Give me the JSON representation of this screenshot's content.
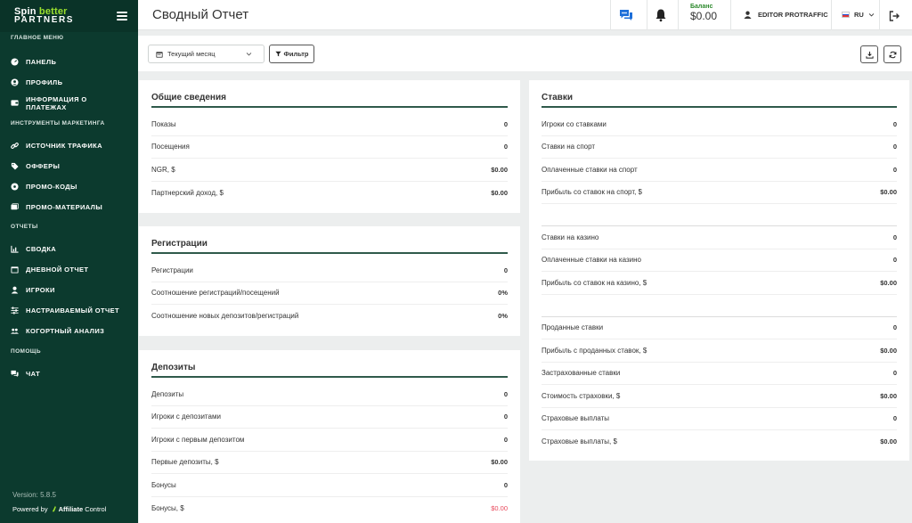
{
  "app": {
    "logo_line1_a": "Spin",
    "logo_line1_b": "better",
    "logo_line2": "PARTNERS",
    "version": "Version: 5.8.5",
    "powered_by": "Powered by",
    "powered_brand_a": "Affiliate",
    "powered_brand_b": "Control"
  },
  "sidebar": {
    "sections": [
      {
        "title": "ГЛАВНОЕ МЕНЮ",
        "items": [
          {
            "label": "ПАНЕЛЬ",
            "icon": "dashboard-icon"
          },
          {
            "label": "ПРОФИЛЬ",
            "icon": "user-icon"
          },
          {
            "label": "ИНФОРМАЦИЯ О ПЛАТЕЖАХ",
            "icon": "wallet-icon"
          }
        ]
      },
      {
        "title": "ИНСТРУМЕНТЫ МАРКЕТИНГА",
        "items": [
          {
            "label": "ИСТОЧНИК ТРАФИКА",
            "icon": "link-icon"
          },
          {
            "label": "ОФФЕРЫ",
            "icon": "tag-icon"
          },
          {
            "label": "ПРОМО-КОДЫ",
            "icon": "promo-icon"
          },
          {
            "label": "ПРОМО-МАТЕРИАЛЫ",
            "icon": "images-icon"
          }
        ]
      },
      {
        "title": "ОТЧЕТЫ",
        "items": [
          {
            "label": "СВОДКА",
            "icon": "chart-icon"
          },
          {
            "label": "ДНЕВНОЙ ОТЧЕТ",
            "icon": "calendar-icon"
          },
          {
            "label": "ИГРОКИ",
            "icon": "user-icon"
          },
          {
            "label": "НАСТРАИВАЕМЫЙ ОТЧЕТ",
            "icon": "sliders-icon"
          },
          {
            "label": "КОГОРТНЫЙ АНАЛИЗ",
            "icon": "users-icon"
          }
        ]
      },
      {
        "title": "ПОМОЩЬ",
        "items": [
          {
            "label": "ЧАТ",
            "icon": "chat-icon"
          }
        ]
      }
    ]
  },
  "header": {
    "title": "Сводный Отчет",
    "balance_label": "Баланс",
    "balance_value": "$0.00",
    "user_name": "EDITOR PROTRAFFIC",
    "language": "RU"
  },
  "toolbar": {
    "date_range": "Текущий месяц",
    "filter_label": "Фильтр"
  },
  "cards": {
    "general": {
      "title": "Общие сведения",
      "rows": [
        {
          "label": "Показы",
          "value": "0"
        },
        {
          "label": "Посещения",
          "value": "0"
        },
        {
          "label": "NGR, $",
          "value": "$0.00"
        },
        {
          "label": "Партнерский доход, $",
          "value": "$0.00"
        }
      ]
    },
    "registrations": {
      "title": "Регистрации",
      "rows": [
        {
          "label": "Регистрации",
          "value": "0"
        },
        {
          "label": "Соотношение регистраций/посещений",
          "value": "0%"
        },
        {
          "label": "Соотношение новых депозитов/регистраций",
          "value": "0%"
        }
      ]
    },
    "deposits": {
      "title": "Депозиты",
      "rows": [
        {
          "label": "Депозиты",
          "value": "0"
        },
        {
          "label": "Игроки с депозитами",
          "value": "0"
        },
        {
          "label": "Игроки с первым депозитом",
          "value": "0"
        },
        {
          "label": "Первые депозиты, $",
          "value": "$0.00"
        },
        {
          "label": "Бонусы",
          "value": "0"
        },
        {
          "label": "Бонусы, $",
          "value": "$0.00"
        }
      ]
    },
    "bets": {
      "title": "Ставки",
      "group1": [
        {
          "label": "Игроки со ставками",
          "value": "0"
        },
        {
          "label": "Ставки на спорт",
          "value": "0"
        },
        {
          "label": "Оплаченные ставки на спорт",
          "value": "0"
        },
        {
          "label": "Прибыль со ставок на спорт, $",
          "value": "$0.00"
        }
      ],
      "group2": [
        {
          "label": "Ставки на казино",
          "value": "0"
        },
        {
          "label": "Оплаченные ставки на казино",
          "value": "0"
        },
        {
          "label": "Прибыль со ставок на казино, $",
          "value": "$0.00"
        }
      ],
      "group3": [
        {
          "label": "Проданные ставки",
          "value": "0"
        },
        {
          "label": "Прибыль с проданных ставок, $",
          "value": "$0.00"
        },
        {
          "label": "Застрахованные ставки",
          "value": "0"
        },
        {
          "label": "Стоимость страховки, $",
          "value": "$0.00"
        },
        {
          "label": "Страховые выплаты",
          "value": "0"
        },
        {
          "label": "Страховые выплаты, $",
          "value": "$0.00"
        }
      ]
    }
  },
  "colors": {
    "sidebar_bg": "#0c3a2e",
    "accent_green": "#9be02e",
    "negative_red": "#e8485b",
    "chat_blue": "#1e6fd9"
  }
}
